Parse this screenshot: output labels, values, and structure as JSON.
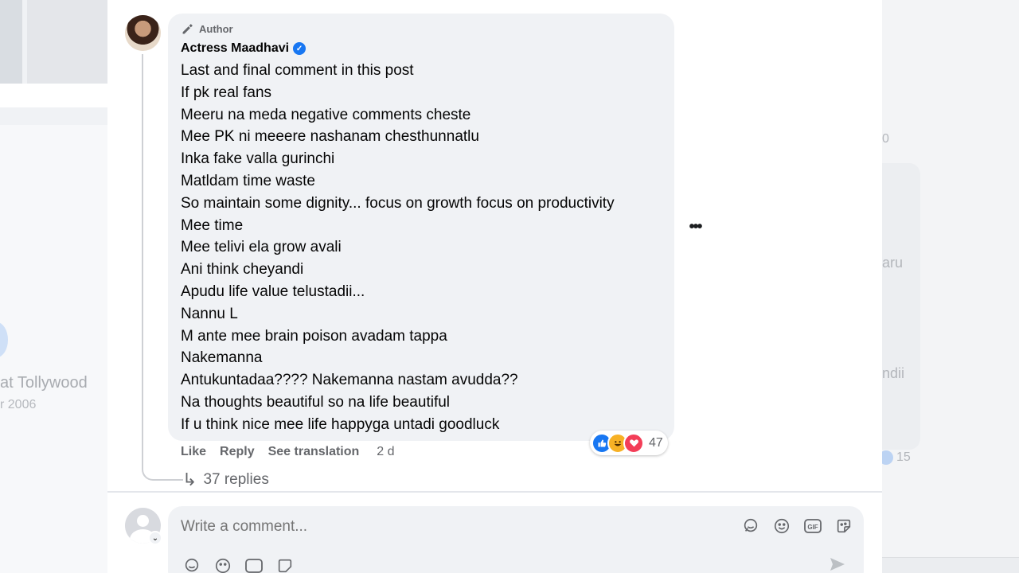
{
  "background": {
    "left_page": {
      "name_fragment": "at Tollywood",
      "sub_fragment": "r 2006"
    },
    "right_page": {
      "t1": "0",
      "t2": "aru",
      "t3": "ndii",
      "react_count": "15"
    }
  },
  "comment": {
    "badge": "Author",
    "author_name": "Actress Maadhavi",
    "verified_icon": "verified-badge-icon",
    "lines": [
      "Last and final comment in this post",
      "If pk real fans",
      "Meeru na meda negative comments cheste",
      "Mee PK ni meeere nashanam chesthunnatlu",
      "Inka fake valla gurinchi",
      "Matldam time waste",
      "So maintain some dignity... focus on growth focus on productivity",
      "Mee time",
      "Mee telivi ela grow avali",
      "Ani think cheyandi",
      "Apudu life value telustadii...",
      "Nannu L",
      "M ante mee brain poison avadam tappa",
      "Nakemanna",
      "Antukuntadaa???? Nakemanna nastam avudda??",
      "Na thoughts beautiful so na life beautiful",
      "If u think nice mee life happyga untadi goodluck"
    ],
    "more_label": "•••",
    "reactions": {
      "icons": [
        "like",
        "haha",
        "love"
      ],
      "count": "47"
    },
    "actions": {
      "like": "Like",
      "reply": "Reply",
      "translate": "See translation",
      "time": "2 d"
    },
    "replies": "37 replies"
  },
  "composer": {
    "placeholder": "Write a comment...",
    "icons": [
      "sticker-avatar-icon",
      "emoji-icon",
      "gif-icon",
      "sticker-icon"
    ]
  },
  "colors": {
    "accent": "#1877f2",
    "bubble": "#f0f2f5",
    "muted": "#65676b",
    "love": "#f33e58",
    "haha": "#f7b125"
  }
}
